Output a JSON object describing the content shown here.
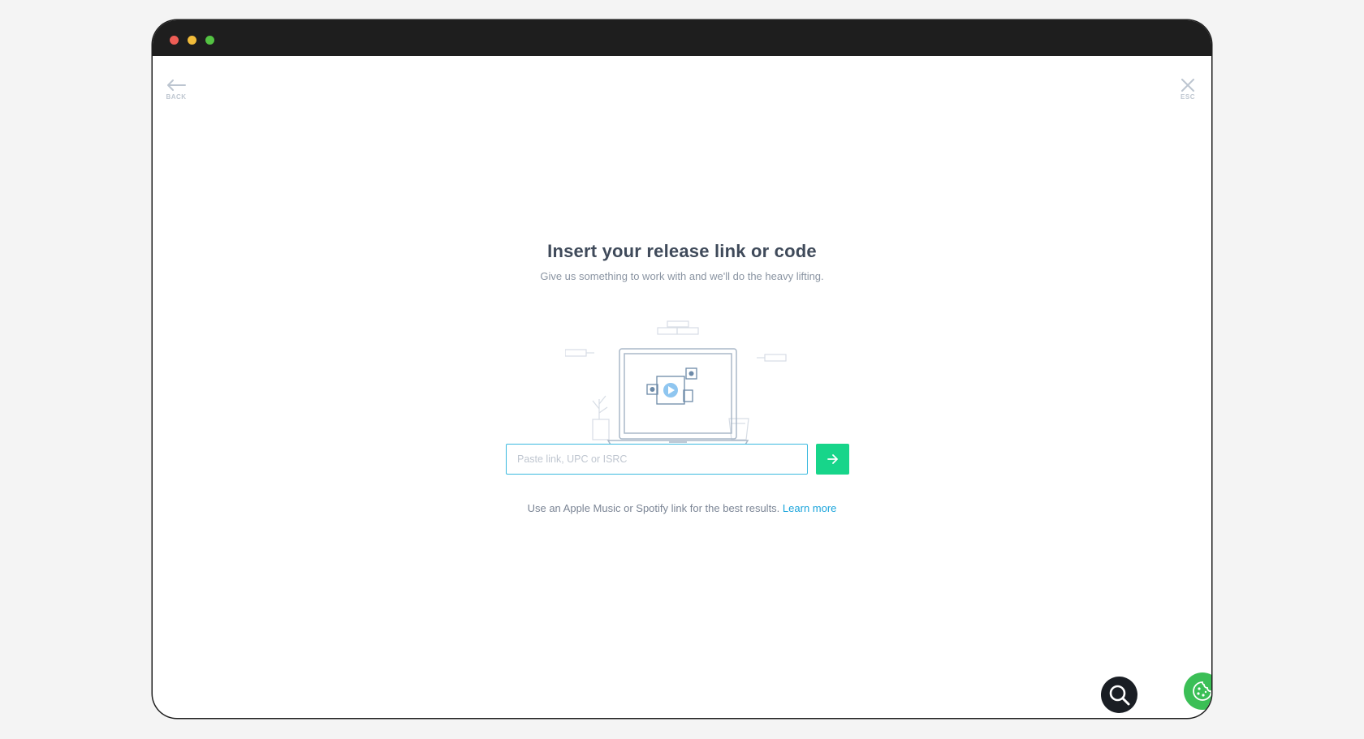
{
  "window": {
    "controls": [
      "close",
      "minimize",
      "maximize"
    ]
  },
  "nav": {
    "back_label": "BACK",
    "esc_label": "ESC"
  },
  "main": {
    "title": "Insert your release link or code",
    "subtitle": "Give us something to work with and we'll do the heavy lifting.",
    "input": {
      "value": "",
      "placeholder": "Paste link, UPC or ISRC"
    },
    "hint_text": "Use an Apple Music or Spotify link for the best results.",
    "learn_more_label": "Learn more"
  },
  "icons": {
    "back": "arrow-left-icon",
    "esc": "close-icon",
    "submit": "arrow-right-icon",
    "search": "search-icon",
    "cookie": "cookie-icon"
  },
  "colors": {
    "accent_green": "#17d58a",
    "link_blue": "#1aa4db",
    "input_border": "#3bb9df",
    "cookie_green": "#3bbf56",
    "titlebar": "#1e1e1e"
  }
}
